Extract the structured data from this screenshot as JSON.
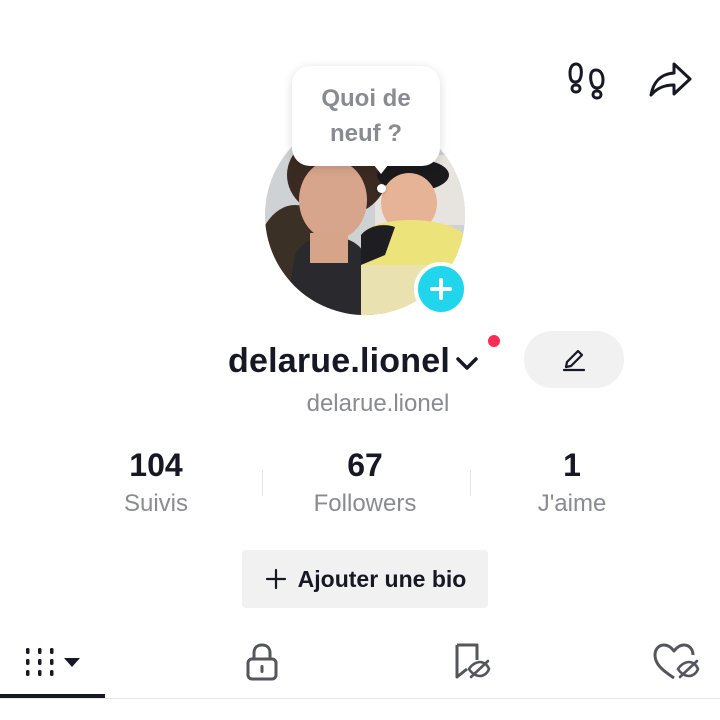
{
  "header": {
    "footprints_icon": "footprints-icon",
    "share_icon": "share-arrow-icon"
  },
  "profile": {
    "bubble_text": "Quoi de neuf ?",
    "username": "delarue.lionel",
    "handle": "delarue.lionel",
    "add_icon": "plus-icon",
    "edit_icon": "pencil-icon",
    "accent_color": "#20d5ec",
    "notification_color": "#fe2c55"
  },
  "stats": [
    {
      "value": "104",
      "label": "Suivis"
    },
    {
      "value": "67",
      "label": "Followers"
    },
    {
      "value": "1",
      "label": "J'aime"
    }
  ],
  "bio": {
    "label": "Ajouter une bio"
  },
  "tabs": [
    {
      "icon": "grid-icon",
      "active": true
    },
    {
      "icon": "lock-icon",
      "active": false
    },
    {
      "icon": "bookmark-hidden-icon",
      "active": false
    },
    {
      "icon": "heart-hidden-icon",
      "active": false
    }
  ]
}
